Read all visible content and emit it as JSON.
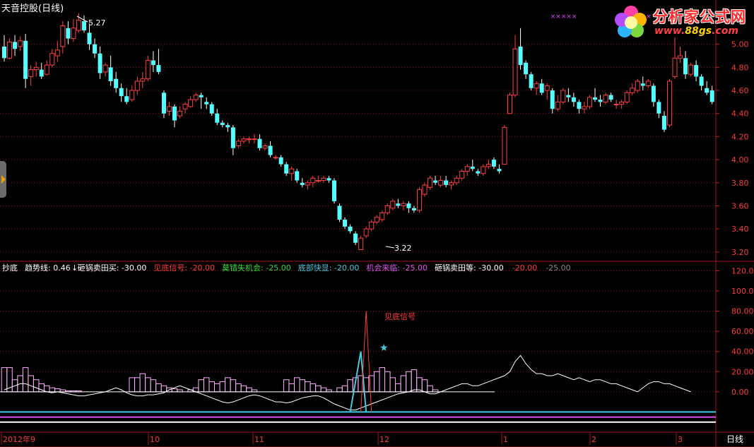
{
  "header": {
    "stock_name": "天音控股",
    "period_label": "(日线)"
  },
  "price_axis": {
    "ticks": [
      "5.00",
      "4.80",
      "4.60",
      "4.40",
      "4.20",
      "4.00",
      "3.80",
      "3.60",
      "3.40",
      "3.20"
    ],
    "range": [
      3.15,
      5.2
    ]
  },
  "indicator_axis": {
    "ticks": [
      "120.00",
      "100.00",
      "80.00",
      "60.00",
      "40.00",
      "20.00",
      "0.00"
    ],
    "range": [
      -40,
      128
    ]
  },
  "date_labels": [
    "2012年9",
    "10",
    "11",
    "12",
    "1",
    "2",
    "3"
  ],
  "period_button": "日线",
  "annotations": {
    "high": "5.27",
    "low": "3.22",
    "signal": "见底信号"
  },
  "indicator_legend": [
    {
      "key": "name",
      "text": "抄底",
      "color": "#ffffff"
    },
    {
      "key": "trend",
      "text": "趋势线: 0.46",
      "color": "#ffffff"
    },
    {
      "key": "sell_buy",
      "text": "砸锅卖田买: -30.00",
      "color": "#ffffff"
    },
    {
      "key": "bottom_signal",
      "text": "见底信号: -20.00",
      "color": "#ff3b3b"
    },
    {
      "key": "dont_miss",
      "text": "莫错失机会: -25.00",
      "color": "#33dd33"
    },
    {
      "key": "bottom_fast",
      "text": "底部快显: -20.00",
      "color": "#44ccdd"
    },
    {
      "key": "opportunity",
      "text": "机会来临: -25.00",
      "color": "#dd55ee"
    },
    {
      "key": "sell_wait",
      "text": "砸锅卖田等: -30.00",
      "color": "#ffffff"
    },
    {
      "key": "v1",
      "text": "-20.00",
      "color": "#ff3b3b"
    },
    {
      "key": "v2",
      "text": "-25.00",
      "color": "#888888"
    }
  ],
  "logo": {
    "brand": "分析家公式网",
    "url_prefix": "www.",
    "url_main": "88gs",
    "url_suffix": ".com"
  },
  "chart_data": {
    "type": "candlestick",
    "candles": [
      [
        4.98,
        5.08,
        4.85,
        4.88
      ],
      [
        4.88,
        5.05,
        4.87,
        5.02
      ],
      [
        5.02,
        5.08,
        4.9,
        4.96
      ],
      [
        4.98,
        5.07,
        4.94,
        5.03
      ],
      [
        5.03,
        5.09,
        4.62,
        4.7
      ],
      [
        4.72,
        4.82,
        4.64,
        4.78
      ],
      [
        4.78,
        4.85,
        4.72,
        4.8
      ],
      [
        4.78,
        4.84,
        4.7,
        4.72
      ],
      [
        4.74,
        4.86,
        4.73,
        4.82
      ],
      [
        4.82,
        4.96,
        4.8,
        4.92
      ],
      [
        4.9,
        5.03,
        4.85,
        4.95
      ],
      [
        4.98,
        5.2,
        4.92,
        5.16
      ],
      [
        5.14,
        5.2,
        5.0,
        5.05
      ],
      [
        5.05,
        5.22,
        5.02,
        5.14
      ],
      [
        5.12,
        5.27,
        5.1,
        5.21
      ],
      [
        5.2,
        5.25,
        5.1,
        5.12
      ],
      [
        5.1,
        5.18,
        4.95,
        5.0
      ],
      [
        5.0,
        5.05,
        4.88,
        4.92
      ],
      [
        4.92,
        4.98,
        4.7,
        4.75
      ],
      [
        4.76,
        4.84,
        4.72,
        4.82
      ],
      [
        4.8,
        4.9,
        4.64,
        4.68
      ],
      [
        4.7,
        4.76,
        4.58,
        4.62
      ],
      [
        4.62,
        4.66,
        4.5,
        4.55
      ],
      [
        4.55,
        4.62,
        4.48,
        4.5
      ],
      [
        4.52,
        4.64,
        4.5,
        4.6
      ],
      [
        4.6,
        4.72,
        4.56,
        4.68
      ],
      [
        4.68,
        4.76,
        4.62,
        4.7
      ],
      [
        4.7,
        4.9,
        4.68,
        4.86
      ],
      [
        4.86,
        4.94,
        4.76,
        4.82
      ],
      [
        4.82,
        4.96,
        4.74,
        4.76
      ],
      [
        4.58,
        4.6,
        4.36,
        4.4
      ],
      [
        4.42,
        4.5,
        4.38,
        4.46
      ],
      [
        4.46,
        4.48,
        4.28,
        4.34
      ],
      [
        4.38,
        4.46,
        4.36,
        4.42
      ],
      [
        4.44,
        4.5,
        4.4,
        4.48
      ],
      [
        4.46,
        4.55,
        4.45,
        4.52
      ],
      [
        4.52,
        4.58,
        4.5,
        4.56
      ],
      [
        4.56,
        4.58,
        4.44,
        4.54
      ],
      [
        4.5,
        4.54,
        4.44,
        4.48
      ],
      [
        4.48,
        4.5,
        4.38,
        4.4
      ],
      [
        4.4,
        4.44,
        4.3,
        4.32
      ],
      [
        4.32,
        4.34,
        4.28,
        4.3
      ],
      [
        4.3,
        4.32,
        4.24,
        4.28
      ],
      [
        4.28,
        4.3,
        4.04,
        4.1
      ],
      [
        4.12,
        4.18,
        4.1,
        4.16
      ],
      [
        4.16,
        4.2,
        4.14,
        4.18
      ],
      [
        4.18,
        4.2,
        4.14,
        4.18
      ],
      [
        4.18,
        4.22,
        4.14,
        4.18
      ],
      [
        4.18,
        4.22,
        4.08,
        4.1
      ],
      [
        4.1,
        4.14,
        4.08,
        4.12
      ],
      [
        4.12,
        4.16,
        4.02,
        4.04
      ],
      [
        4.02,
        4.04,
        4.0,
        4.02
      ],
      [
        4.02,
        4.04,
        3.94,
        3.96
      ],
      [
        3.96,
        3.98,
        3.86,
        3.88
      ],
      [
        3.88,
        3.94,
        3.82,
        3.92
      ],
      [
        3.9,
        3.92,
        3.8,
        3.82
      ],
      [
        3.8,
        3.84,
        3.76,
        3.78
      ],
      [
        3.78,
        3.82,
        3.74,
        3.8
      ],
      [
        3.8,
        3.86,
        3.76,
        3.84
      ],
      [
        3.82,
        3.86,
        3.8,
        3.82
      ],
      [
        3.82,
        3.86,
        3.8,
        3.84
      ],
      [
        3.84,
        3.86,
        3.8,
        3.82
      ],
      [
        3.82,
        3.84,
        3.62,
        3.64
      ],
      [
        3.6,
        3.62,
        3.46,
        3.48
      ],
      [
        3.48,
        3.5,
        3.4,
        3.42
      ],
      [
        3.42,
        3.44,
        3.36,
        3.38
      ],
      [
        3.36,
        3.38,
        3.26,
        3.28
      ],
      [
        3.22,
        3.34,
        3.22,
        3.32
      ],
      [
        3.34,
        3.42,
        3.32,
        3.4
      ],
      [
        3.4,
        3.48,
        3.38,
        3.46
      ],
      [
        3.46,
        3.52,
        3.44,
        3.5
      ],
      [
        3.48,
        3.56,
        3.46,
        3.54
      ],
      [
        3.54,
        3.62,
        3.52,
        3.6
      ],
      [
        3.58,
        3.66,
        3.56,
        3.64
      ],
      [
        3.62,
        3.66,
        3.58,
        3.6
      ],
      [
        3.6,
        3.64,
        3.56,
        3.62
      ],
      [
        3.62,
        3.64,
        3.54,
        3.58
      ],
      [
        3.58,
        3.6,
        3.54,
        3.56
      ],
      [
        3.56,
        3.76,
        3.54,
        3.74
      ],
      [
        3.7,
        3.8,
        3.68,
        3.78
      ],
      [
        3.76,
        3.86,
        3.74,
        3.84
      ],
      [
        3.82,
        3.86,
        3.78,
        3.8
      ],
      [
        3.78,
        3.86,
        3.76,
        3.82
      ],
      [
        3.82,
        3.86,
        3.76,
        3.78
      ],
      [
        3.78,
        3.82,
        3.74,
        3.8
      ],
      [
        3.8,
        3.86,
        3.78,
        3.84
      ],
      [
        3.84,
        3.92,
        3.82,
        3.9
      ],
      [
        3.9,
        3.96,
        3.86,
        3.94
      ],
      [
        3.94,
        4.0,
        3.9,
        3.92
      ],
      [
        3.9,
        3.92,
        3.86,
        3.88
      ],
      [
        3.88,
        3.96,
        3.86,
        3.94
      ],
      [
        3.94,
        4.0,
        3.92,
        3.96
      ],
      [
        4.0,
        4.02,
        3.92,
        3.94
      ],
      [
        3.92,
        3.96,
        3.88,
        3.9
      ],
      [
        3.96,
        4.3,
        3.96,
        4.28
      ],
      [
        4.4,
        4.58,
        4.4,
        4.56
      ],
      [
        4.56,
        5.08,
        4.54,
        4.96
      ],
      [
        4.98,
        5.14,
        4.78,
        4.82
      ],
      [
        4.84,
        4.86,
        4.7,
        4.74
      ],
      [
        4.74,
        4.76,
        4.6,
        4.62
      ],
      [
        4.62,
        4.68,
        4.56,
        4.66
      ],
      [
        4.66,
        4.7,
        4.56,
        4.58
      ],
      [
        4.6,
        4.66,
        4.52,
        4.64
      ],
      [
        4.6,
        4.62,
        4.4,
        4.44
      ],
      [
        4.44,
        4.56,
        4.42,
        4.5
      ],
      [
        4.5,
        4.62,
        4.48,
        4.6
      ],
      [
        4.56,
        4.62,
        4.5,
        4.54
      ],
      [
        4.54,
        4.58,
        4.46,
        4.5
      ],
      [
        4.5,
        4.52,
        4.4,
        4.44
      ],
      [
        4.44,
        4.5,
        4.4,
        4.46
      ],
      [
        4.46,
        4.56,
        4.44,
        4.54
      ],
      [
        4.54,
        4.62,
        4.5,
        4.52
      ],
      [
        4.52,
        4.56,
        4.46,
        4.5
      ],
      [
        4.5,
        4.58,
        4.48,
        4.56
      ],
      [
        4.56,
        4.58,
        4.5,
        4.52
      ],
      [
        4.48,
        4.52,
        4.44,
        4.48
      ],
      [
        4.48,
        4.52,
        4.44,
        4.5
      ],
      [
        4.5,
        4.6,
        4.48,
        4.58
      ],
      [
        4.58,
        4.66,
        4.56,
        4.62
      ],
      [
        4.6,
        4.7,
        4.58,
        4.68
      ],
      [
        4.66,
        4.72,
        4.6,
        4.64
      ],
      [
        4.64,
        4.7,
        4.62,
        4.68
      ],
      [
        4.64,
        4.66,
        4.46,
        4.5
      ],
      [
        4.5,
        4.52,
        4.36,
        4.4
      ],
      [
        4.38,
        4.42,
        4.24,
        4.26
      ],
      [
        4.3,
        4.7,
        4.28,
        4.68
      ],
      [
        4.72,
        5.06,
        4.7,
        4.88
      ],
      [
        4.88,
        4.98,
        4.84,
        4.9
      ],
      [
        4.88,
        4.94,
        4.7,
        4.74
      ],
      [
        4.74,
        4.84,
        4.72,
        4.82
      ],
      [
        4.82,
        4.86,
        4.68,
        4.72
      ],
      [
        4.72,
        4.74,
        4.6,
        4.64
      ],
      [
        4.62,
        4.68,
        4.56,
        4.58
      ],
      [
        4.6,
        4.64,
        4.48,
        4.5
      ]
    ],
    "signal_marks_x_index": [
      103,
      104,
      105,
      106,
      107,
      116,
      121,
      127,
      128,
      129
    ],
    "indicator_bars": [
      24,
      24,
      12,
      16,
      24,
      16,
      12,
      8,
      6,
      4,
      3,
      2,
      1,
      1,
      1,
      0,
      0,
      0,
      0,
      0,
      0,
      0,
      0,
      0,
      14,
      14,
      18,
      14,
      12,
      8,
      6,
      4,
      3,
      2,
      0,
      2,
      4,
      12,
      14,
      10,
      8,
      10,
      14,
      12,
      8,
      6,
      4,
      2,
      0,
      0,
      0,
      0,
      0,
      12,
      8,
      14,
      12,
      10,
      8,
      6,
      4,
      2,
      0,
      4,
      6,
      12,
      14,
      16,
      14,
      16,
      20,
      24,
      20,
      14,
      8,
      16,
      20,
      22,
      14,
      12,
      6,
      2,
      0,
      0,
      0,
      0,
      0,
      0,
      0,
      0,
      0,
      0,
      0,
      0,
      0,
      0,
      0,
      0,
      0,
      0,
      0,
      0,
      0,
      0,
      0,
      0,
      0,
      0,
      0,
      0,
      0,
      0,
      0,
      0,
      0,
      0,
      0,
      0,
      0,
      0,
      0,
      0,
      0,
      0,
      0,
      0,
      0,
      0,
      0,
      0,
      0,
      0,
      0,
      0,
      0,
      0,
      0
    ],
    "trend_line": [
      2,
      4,
      6,
      8,
      8,
      6,
      4,
      2,
      0,
      -1,
      0,
      -1,
      -2,
      -3,
      -4,
      -4,
      -3,
      -2,
      -1,
      0,
      2,
      4,
      2,
      -1,
      -3,
      -4,
      -4,
      -3,
      -3,
      -2,
      -1,
      2,
      4,
      6,
      4,
      2,
      0,
      -2,
      -4,
      -6,
      -8,
      -10,
      -11,
      -10,
      -8,
      -6,
      -4,
      -3,
      -4,
      -6,
      -8,
      -10,
      -10,
      -11,
      -10,
      -8,
      -6,
      -5,
      -4,
      -4,
      -6,
      -9,
      -12,
      -14,
      -16,
      -18,
      -18,
      -16,
      -14,
      -12,
      -10,
      -8,
      -6,
      -4,
      -2,
      -1,
      0,
      2,
      2,
      0,
      -2,
      -2,
      0,
      2,
      4,
      6,
      8,
      8,
      6,
      6,
      8,
      10,
      12,
      14,
      16,
      20,
      30,
      36,
      28,
      22,
      18,
      18,
      16,
      16,
      18,
      16,
      14,
      12,
      14,
      12,
      10,
      12,
      12,
      10,
      8,
      8,
      6,
      4,
      2,
      0,
      4,
      8,
      10,
      10,
      8,
      8,
      6,
      4,
      2,
      0
    ]
  }
}
